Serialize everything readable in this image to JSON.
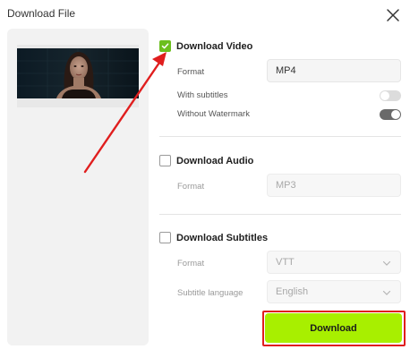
{
  "dialog": {
    "title": "Download File",
    "close_icon": "close-icon"
  },
  "video": {
    "label": "Download Video",
    "checked": true,
    "format_label": "Format",
    "format_value": "MP4",
    "subtitles_label": "With subtitles",
    "subtitles_on": false,
    "watermark_label": "Without Watermark",
    "watermark_on": true
  },
  "audio": {
    "label": "Download Audio",
    "checked": false,
    "format_label": "Format",
    "format_value": "MP3"
  },
  "subtitles": {
    "label": "Download Subtitles",
    "checked": false,
    "format_label": "Format",
    "format_value": "VTT",
    "language_label": "Subtitle language",
    "language_value": "English"
  },
  "actions": {
    "download_label": "Download"
  },
  "colors": {
    "accent_green": "#a8ef00",
    "checkbox_green": "#6cbf1e",
    "annotation_red": "#e01e1e"
  }
}
